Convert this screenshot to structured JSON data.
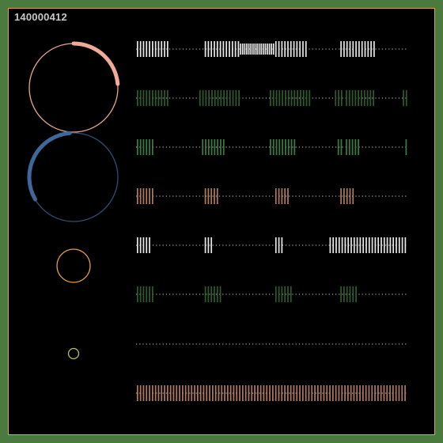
{
  "header": {
    "id_label": "140000412"
  },
  "colors": {
    "background": "#000000",
    "frame_border": "#d9a93a",
    "outer_border": "#4a7a3e"
  },
  "circles": [
    {
      "name": "circle-1",
      "ring_color": "#e8a88e",
      "arc_color": "#f0aa98",
      "arc_from_deg": 270,
      "arc_to_deg": 355
    },
    {
      "name": "circle-2",
      "ring_color": "#2e4f78",
      "arc_color": "#3d6899",
      "arc_from_deg": 150,
      "arc_to_deg": 265
    },
    {
      "name": "circle-3",
      "ring_color": "#e8a040"
    },
    {
      "name": "circle-4",
      "ring_color": "#b8c060"
    }
  ],
  "tracks": [
    {
      "name": "track-1",
      "color": "#e8e8e8",
      "segments": [
        [
          0.0,
          0.12
        ],
        [
          0.25,
          0.38
        ],
        [
          0.38,
          0.51
        ],
        [
          0.51,
          0.63
        ],
        [
          0.75,
          0.88
        ]
      ],
      "dense_segments": [
        [
          0.38,
          0.51
        ]
      ]
    },
    {
      "name": "track-2",
      "color": "#2e5a2e",
      "segments": [
        [
          0.0,
          0.12
        ],
        [
          0.23,
          0.38
        ],
        [
          0.49,
          0.64
        ],
        [
          0.73,
          0.76
        ],
        [
          0.77,
          0.88
        ],
        [
          0.98,
          1.0
        ]
      ]
    },
    {
      "name": "track-3",
      "color": "#3e7a44",
      "segments": [
        [
          0.0,
          0.07
        ],
        [
          0.24,
          0.33
        ],
        [
          0.49,
          0.59
        ],
        [
          0.74,
          0.76
        ],
        [
          0.77,
          0.82
        ],
        [
          0.99,
          1.0
        ]
      ]
    },
    {
      "name": "track-4",
      "color": "#b07a60",
      "segments": [
        [
          0.0,
          0.06
        ],
        [
          0.25,
          0.3
        ],
        [
          0.51,
          0.56
        ],
        [
          0.75,
          0.8
        ]
      ]
    },
    {
      "name": "track-5",
      "color": "#e8e8e8",
      "segments": [
        [
          0.0,
          0.05
        ],
        [
          0.25,
          0.28
        ],
        [
          0.51,
          0.54
        ],
        [
          0.71,
          1.0
        ]
      ]
    },
    {
      "name": "track-6",
      "color": "#2e5a2e",
      "segments": [
        [
          0.0,
          0.07
        ],
        [
          0.25,
          0.31
        ],
        [
          0.51,
          0.57
        ],
        [
          0.75,
          0.81
        ]
      ]
    },
    {
      "name": "track-7",
      "color": "#e8e8e8",
      "segments": []
    },
    {
      "name": "track-8",
      "color": "#b07a60",
      "segments": [
        [
          0.0,
          1.0
        ]
      ]
    }
  ]
}
